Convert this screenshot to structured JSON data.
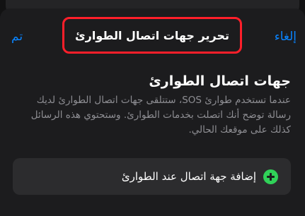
{
  "nav": {
    "cancel_label": "إلغاء",
    "title": "تحرير جهات اتصال الطوارئ",
    "done_label": "تم"
  },
  "section": {
    "heading": "جهات اتصال الطوارئ",
    "description": "عندما تستخدم طوارئ SOS، ستتلقى جهات اتصال الطوارئ لديك رسالة توضح أنك اتصلت بخدمات الطوارئ. وستحتوي هذه الرسائل كذلك على موقعك الحالي."
  },
  "add_contact": {
    "label": "إضافة جهة اتصال عند الطوارئ",
    "icon": "plus-circle-icon"
  },
  "colors": {
    "accent": "#0a84ff",
    "add_icon": "#30d158",
    "highlight_border": "#ff1f2a"
  }
}
